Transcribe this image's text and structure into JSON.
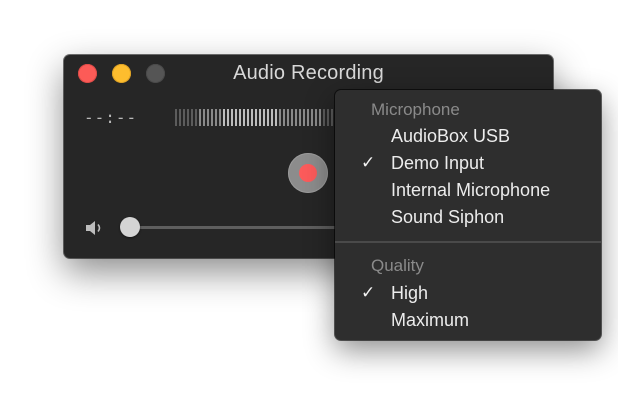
{
  "window": {
    "title": "Audio Recording",
    "time_display": "--:--",
    "meter": {
      "level": 0.92
    }
  },
  "menu": {
    "sections": [
      {
        "header": "Microphone",
        "items": [
          {
            "label": "AudioBox USB",
            "checked": false
          },
          {
            "label": "Demo Input",
            "checked": true
          },
          {
            "label": "Internal Microphone",
            "checked": false
          },
          {
            "label": "Sound Siphon",
            "checked": false
          }
        ]
      },
      {
        "header": "Quality",
        "items": [
          {
            "label": "High",
            "checked": true
          },
          {
            "label": "Maximum",
            "checked": false
          }
        ]
      }
    ],
    "check_glyph": "✓"
  },
  "colors": {
    "close": "#fc5b57",
    "minimize": "#fdbd2e",
    "record": "#fc5b5b",
    "window_bg": "#262626",
    "menu_bg": "#2e2e2e"
  }
}
